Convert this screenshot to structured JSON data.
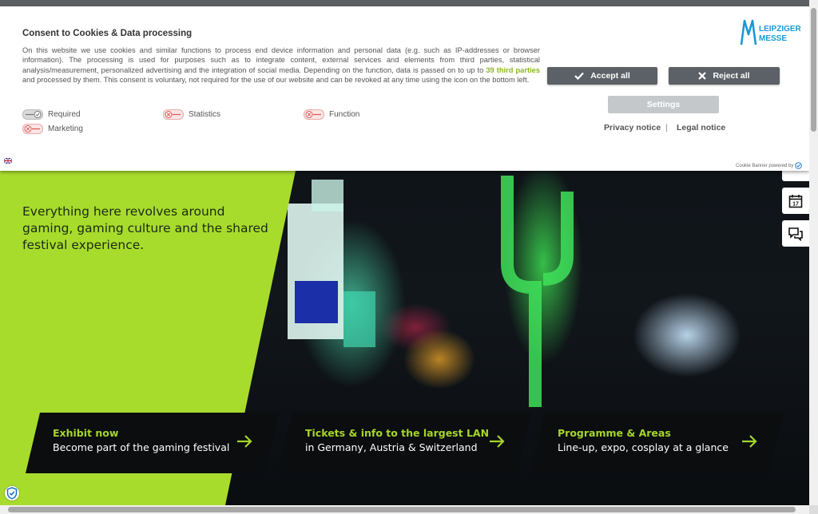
{
  "hero": {
    "tagline": "Everything here revolves around gaming, gaming culture and the shared festival experience."
  },
  "tiles": [
    {
      "title": "Exhibit now",
      "subtitle": "Become part of the gaming festival"
    },
    {
      "title": "Tickets & info to the largest LAN",
      "subtitle": "in Germany, Austria & Switzerland"
    },
    {
      "title": "Programme & Areas",
      "subtitle": "Line-up, expo, cosplay at a glance"
    }
  ],
  "side_buttons": [
    {
      "icon": "calendar-icon",
      "text": "17"
    },
    {
      "icon": "chat-icon"
    }
  ],
  "cookie": {
    "title": "Consent to Cookies & Data processing",
    "desc_before": "On this website we use cookies and similar functions to process end device information and personal data (e.g. such as IP-addresses or browser information). The processing is used for purposes such as to integrate content, external services and elements from third parties, statistical analysis/measurement, personalized advertising and the integration of social media. Depending on the function, data is passed on to up to ",
    "desc_link": "39 third parties",
    "desc_after": " and processed by them. This consent is voluntary, not required for the use of our website and can be revoked at any time using the icon on the bottom left.",
    "toggles": {
      "required": "Required",
      "statistics": "Statistics",
      "function": "Function",
      "marketing": "Marketing"
    },
    "accept_all": "Accept all",
    "reject_all": "Reject all",
    "settings": "Settings",
    "privacy_notice": "Privacy notice",
    "separator": "|",
    "legal_notice": "Legal notice",
    "powered_by": "Cookie Banner powered by",
    "logo_line1": "LEIPZIGER",
    "logo_line2": "MESSE"
  },
  "colors": {
    "accent_green": "#a5d52a",
    "panel_green": "#a8dc2c",
    "button_dark": "#5b6166",
    "logo_blue": "#1a9ad6"
  }
}
